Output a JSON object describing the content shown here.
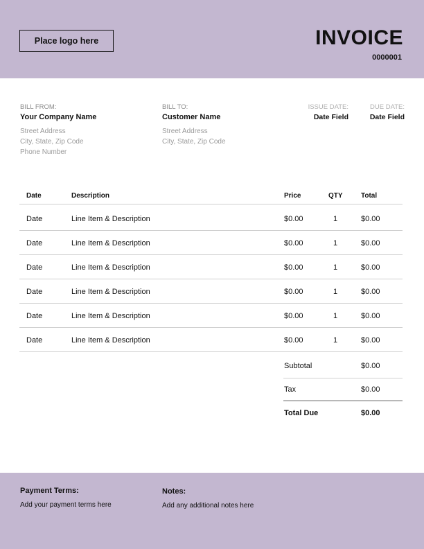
{
  "header": {
    "logo": "Place logo here",
    "title": "INVOICE",
    "number": "0000001"
  },
  "bill_from": {
    "label": "BILL FROM:",
    "name": "Your Company Name",
    "street": "Street Address",
    "city": "City, State, Zip Code",
    "phone": "Phone Number"
  },
  "bill_to": {
    "label": "BILL TO:",
    "name": "Customer Name",
    "street": "Street Address",
    "city": "City, State, Zip Code"
  },
  "issue": {
    "label": "ISSUE DATE:",
    "value": "Date Field"
  },
  "due": {
    "label": "DUE DATE:",
    "value": "Date Field"
  },
  "columns": {
    "date": "Date",
    "desc": "Description",
    "price": "Price",
    "qty": "QTY",
    "total": "Total"
  },
  "rows": [
    {
      "date": "Date",
      "desc": "Line Item & Description",
      "price": "$0.00",
      "qty": "1",
      "total": "$0.00"
    },
    {
      "date": "Date",
      "desc": "Line Item & Description",
      "price": "$0.00",
      "qty": "1",
      "total": "$0.00"
    },
    {
      "date": "Date",
      "desc": "Line Item & Description",
      "price": "$0.00",
      "qty": "1",
      "total": "$0.00"
    },
    {
      "date": "Date",
      "desc": "Line Item & Description",
      "price": "$0.00",
      "qty": "1",
      "total": "$0.00"
    },
    {
      "date": "Date",
      "desc": "Line Item & Description",
      "price": "$0.00",
      "qty": "1",
      "total": "$0.00"
    },
    {
      "date": "Date",
      "desc": "Line Item & Description",
      "price": "$0.00",
      "qty": "1",
      "total": "$0.00"
    }
  ],
  "summary": {
    "subtotal_label": "Subtotal",
    "subtotal": "$0.00",
    "tax_label": "Tax",
    "tax": "$0.00",
    "due_label": "Total Due",
    "due": "$0.00"
  },
  "footer": {
    "terms_label": "Payment Terms:",
    "terms": "Add your payment terms here",
    "notes_label": "Notes:",
    "notes": "Add any additional notes here"
  },
  "colors": {
    "band": "#c3b7d0"
  }
}
